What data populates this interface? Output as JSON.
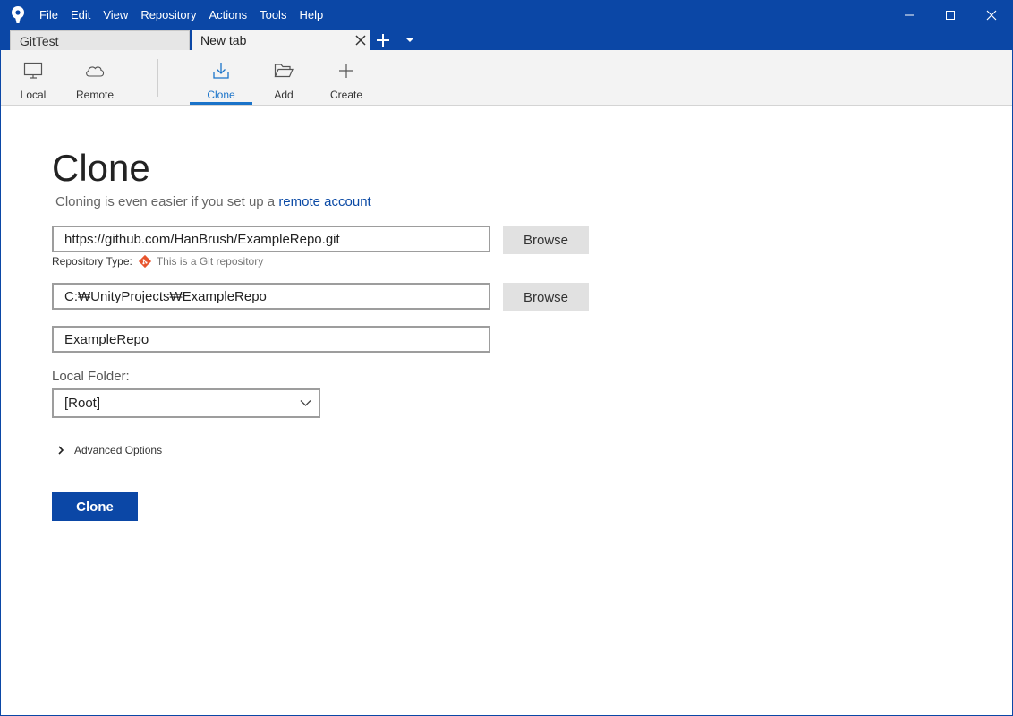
{
  "menu": [
    "File",
    "Edit",
    "View",
    "Repository",
    "Actions",
    "Tools",
    "Help"
  ],
  "tabs": [
    {
      "label": "GitTest",
      "active": false
    },
    {
      "label": "New tab",
      "active": true
    }
  ],
  "toolbar": {
    "local": "Local",
    "remote": "Remote",
    "clone": "Clone",
    "add": "Add",
    "create": "Create"
  },
  "page": {
    "title": "Clone",
    "subtitle_prefix": "Cloning is even easier if you set up a ",
    "subtitle_link": "remote account"
  },
  "form": {
    "source_url": "https://github.com/HanBrush/ExampleRepo.git",
    "browse_label": "Browse",
    "repo_type_label": "Repository Type:",
    "repo_type_value": "This is a Git repository",
    "destination_path": "C:₩UnityProjects₩ExampleRepo",
    "name": "ExampleRepo",
    "local_folder_label": "Local Folder:",
    "local_folder_value": "[Root]",
    "advanced_label": "Advanced Options",
    "clone_button": "Clone"
  },
  "colors": {
    "brand": "#0b47a6",
    "accent": "#1a73c9",
    "link": "#0b4aa5",
    "git": "#e8542d"
  }
}
